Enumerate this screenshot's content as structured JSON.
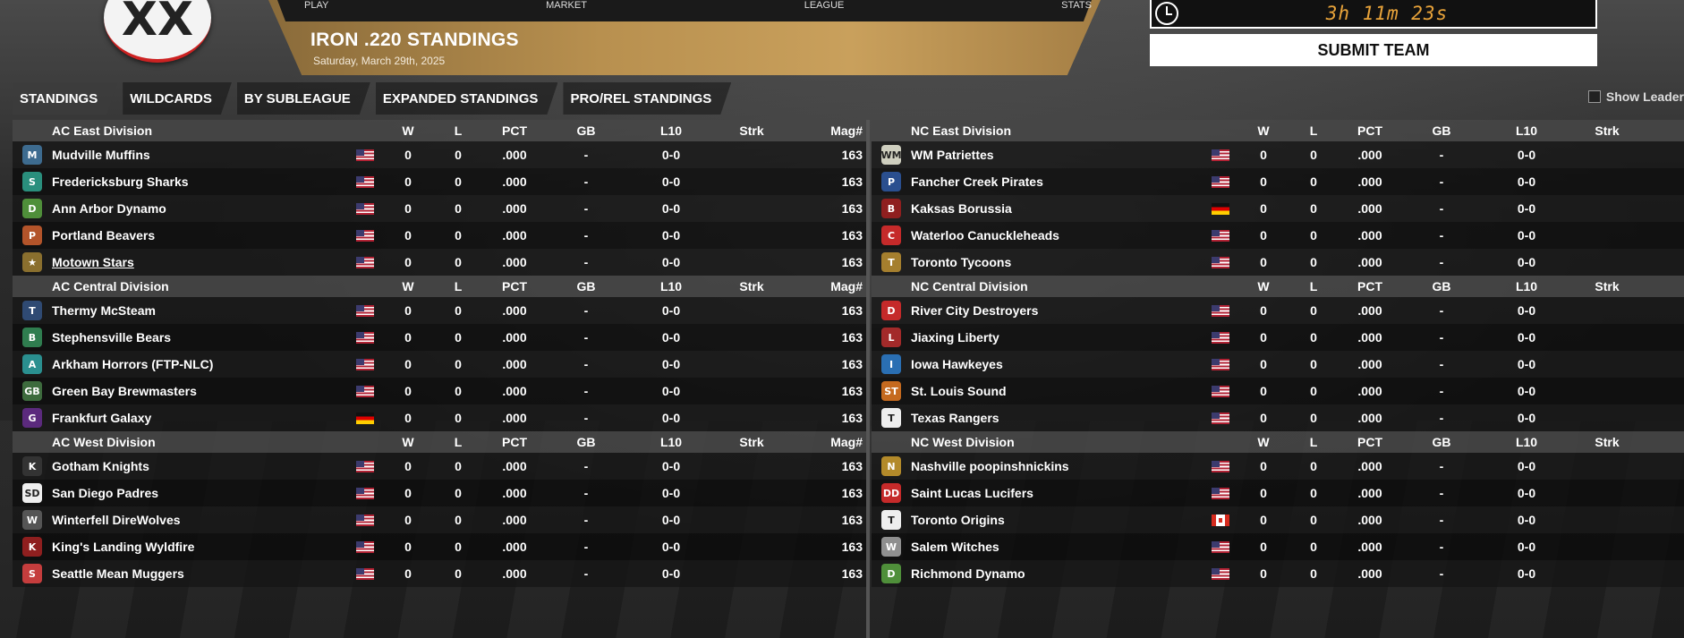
{
  "header": {
    "logo_glyph": "XX",
    "top_menu": [
      "PLAY",
      "MARKET",
      "LEAGUE",
      "STATS"
    ],
    "title": "IRON .220 STANDINGS",
    "date": "Saturday, March 29th, 2025",
    "timer": "3h 11m 23s",
    "submit_label": "SUBMIT TEAM"
  },
  "tabs": [
    {
      "label": "STANDINGS",
      "active": true
    },
    {
      "label": "WILDCARDS",
      "active": false
    },
    {
      "label": "BY SUBLEAGUE",
      "active": false
    },
    {
      "label": "EXPANDED STANDINGS",
      "active": false
    },
    {
      "label": "PRO/REL STANDINGS",
      "active": false
    }
  ],
  "show_leader_label": "Show Leader",
  "columns": {
    "w": "W",
    "l": "L",
    "pct": "PCT",
    "gb": "GB",
    "l10": "L10",
    "strk": "Strk",
    "mag": "Mag#"
  },
  "left": [
    {
      "division": "AC East Division",
      "teams": [
        {
          "name": "Mudville Muffins",
          "flag": "us",
          "color": "#3d6b8f",
          "abbr": "M",
          "w": "0",
          "l": "0",
          "pct": ".000",
          "gb": "-",
          "l10": "0-0",
          "strk": "",
          "mag": "163"
        },
        {
          "name": "Fredericksburg Sharks",
          "flag": "us",
          "color": "#2a8f7d",
          "abbr": "S",
          "w": "0",
          "l": "0",
          "pct": ".000",
          "gb": "-",
          "l10": "0-0",
          "strk": "",
          "mag": "163"
        },
        {
          "name": "Ann Arbor Dynamo",
          "flag": "us",
          "color": "#4f8f3a",
          "abbr": "D",
          "w": "0",
          "l": "0",
          "pct": ".000",
          "gb": "-",
          "l10": "0-0",
          "strk": "",
          "mag": "163"
        },
        {
          "name": "Portland Beavers",
          "flag": "us",
          "color": "#b3542a",
          "abbr": "P",
          "w": "0",
          "l": "0",
          "pct": ".000",
          "gb": "-",
          "l10": "0-0",
          "strk": "",
          "mag": "163"
        },
        {
          "name": "Motown Stars",
          "flag": "us",
          "color": "#8a6f2e",
          "abbr": "★",
          "link": true,
          "w": "0",
          "l": "0",
          "pct": ".000",
          "gb": "-",
          "l10": "0-0",
          "strk": "",
          "mag": "163"
        }
      ]
    },
    {
      "division": "AC Central Division",
      "teams": [
        {
          "name": "Thermy McSteam",
          "flag": "us",
          "color": "#2f4a73",
          "abbr": "T",
          "w": "0",
          "l": "0",
          "pct": ".000",
          "gb": "-",
          "l10": "0-0",
          "strk": "",
          "mag": "163"
        },
        {
          "name": "Stephensville Bears",
          "flag": "us",
          "color": "#2f7d4f",
          "abbr": "B",
          "w": "0",
          "l": "0",
          "pct": ".000",
          "gb": "-",
          "l10": "0-0",
          "strk": "",
          "mag": "163"
        },
        {
          "name": "Arkham Horrors (FTP-NLC)",
          "flag": "us",
          "color": "#2a8f8f",
          "abbr": "A",
          "w": "0",
          "l": "0",
          "pct": ".000",
          "gb": "-",
          "l10": "0-0",
          "strk": "",
          "mag": "163"
        },
        {
          "name": "Green Bay Brewmasters",
          "flag": "us",
          "color": "#3d6b3d",
          "abbr": "GB",
          "w": "0",
          "l": "0",
          "pct": ".000",
          "gb": "-",
          "l10": "0-0",
          "strk": "",
          "mag": "163"
        },
        {
          "name": "Frankfurt Galaxy",
          "flag": "de",
          "color": "#5b2a7d",
          "abbr": "G",
          "w": "0",
          "l": "0",
          "pct": ".000",
          "gb": "-",
          "l10": "0-0",
          "strk": "",
          "mag": "163"
        }
      ]
    },
    {
      "division": "AC West Division",
      "teams": [
        {
          "name": "Gotham Knights",
          "flag": "us",
          "color": "#333333",
          "abbr": "K",
          "w": "0",
          "l": "0",
          "pct": ".000",
          "gb": "-",
          "l10": "0-0",
          "strk": "",
          "mag": "163"
        },
        {
          "name": "San Diego Padres",
          "flag": "us",
          "color": "#eeeeee",
          "abbr": "SD",
          "w": "0",
          "l": "0",
          "pct": ".000",
          "gb": "-",
          "l10": "0-0",
          "strk": "",
          "mag": "163"
        },
        {
          "name": "Winterfell DireWolves",
          "flag": "us",
          "color": "#555555",
          "abbr": "W",
          "w": "0",
          "l": "0",
          "pct": ".000",
          "gb": "-",
          "l10": "0-0",
          "strk": "",
          "mag": "163"
        },
        {
          "name": "King's Landing Wyldfire",
          "flag": "us",
          "color": "#8f1f1f",
          "abbr": "K",
          "w": "0",
          "l": "0",
          "pct": ".000",
          "gb": "-",
          "l10": "0-0",
          "strk": "",
          "mag": "163"
        },
        {
          "name": "Seattle Mean Muggers",
          "flag": "us",
          "color": "#c53d3d",
          "abbr": "S",
          "w": "0",
          "l": "0",
          "pct": ".000",
          "gb": "-",
          "l10": "0-0",
          "strk": "",
          "mag": "163"
        }
      ]
    }
  ],
  "right": [
    {
      "division": "NC East Division",
      "teams": [
        {
          "name": "WM Patriettes",
          "flag": "us",
          "color": "#cfcfbf",
          "abbr": "WM",
          "w": "0",
          "l": "0",
          "pct": ".000",
          "gb": "-",
          "l10": "0-0"
        },
        {
          "name": "Fancher Creek Pirates",
          "flag": "us",
          "color": "#2a4f8f",
          "abbr": "P",
          "w": "0",
          "l": "0",
          "pct": ".000",
          "gb": "-",
          "l10": "0-0"
        },
        {
          "name": "Kaksas Borussia",
          "flag": "de",
          "color": "#8f1f1f",
          "abbr": "B",
          "w": "0",
          "l": "0",
          "pct": ".000",
          "gb": "-",
          "l10": "0-0"
        },
        {
          "name": "Waterloo Canuckleheads",
          "flag": "us",
          "color": "#c52a2a",
          "abbr": "C",
          "w": "0",
          "l": "0",
          "pct": ".000",
          "gb": "-",
          "l10": "0-0"
        },
        {
          "name": "Toronto Tycoons",
          "flag": "us",
          "color": "#a57f2e",
          "abbr": "T",
          "w": "0",
          "l": "0",
          "pct": ".000",
          "gb": "-",
          "l10": "0-0"
        }
      ]
    },
    {
      "division": "NC Central Division",
      "teams": [
        {
          "name": "River City Destroyers",
          "flag": "us",
          "color": "#c52a2a",
          "abbr": "D",
          "w": "0",
          "l": "0",
          "pct": ".000",
          "gb": "-",
          "l10": "0-0"
        },
        {
          "name": "Jiaxing Liberty",
          "flag": "us",
          "color": "#a32a2a",
          "abbr": "L",
          "w": "0",
          "l": "0",
          "pct": ".000",
          "gb": "-",
          "l10": "0-0"
        },
        {
          "name": "Iowa Hawkeyes",
          "flag": "us",
          "color": "#2a6fb3",
          "abbr": "I",
          "w": "0",
          "l": "0",
          "pct": ".000",
          "gb": "-",
          "l10": "0-0"
        },
        {
          "name": "St. Louis Sound",
          "flag": "us",
          "color": "#c56a1f",
          "abbr": "ST",
          "w": "0",
          "l": "0",
          "pct": ".000",
          "gb": "-",
          "l10": "0-0"
        },
        {
          "name": "Texas Rangers",
          "flag": "us",
          "color": "#eeeeee",
          "abbr": "T",
          "w": "0",
          "l": "0",
          "pct": ".000",
          "gb": "-",
          "l10": "0-0"
        }
      ]
    },
    {
      "division": "NC West Division",
      "teams": [
        {
          "name": "Nashville poopinshnickins",
          "flag": "us",
          "color": "#b38a2a",
          "abbr": "N",
          "w": "0",
          "l": "0",
          "pct": ".000",
          "gb": "-",
          "l10": "0-0"
        },
        {
          "name": "Saint Lucas Lucifers",
          "flag": "us",
          "color": "#c52a2a",
          "abbr": "DD",
          "w": "0",
          "l": "0",
          "pct": ".000",
          "gb": "-",
          "l10": "0-0"
        },
        {
          "name": "Toronto Origins",
          "flag": "ca",
          "color": "#eeeeee",
          "abbr": "T",
          "w": "0",
          "l": "0",
          "pct": ".000",
          "gb": "-",
          "l10": "0-0"
        },
        {
          "name": "Salem Witches",
          "flag": "us",
          "color": "#8f8f8f",
          "abbr": "W",
          "w": "0",
          "l": "0",
          "pct": ".000",
          "gb": "-",
          "l10": "0-0"
        },
        {
          "name": "Richmond Dynamo",
          "flag": "us",
          "color": "#4f8f3a",
          "abbr": "D",
          "w": "0",
          "l": "0",
          "pct": ".000",
          "gb": "-",
          "l10": "0-0"
        }
      ]
    }
  ]
}
